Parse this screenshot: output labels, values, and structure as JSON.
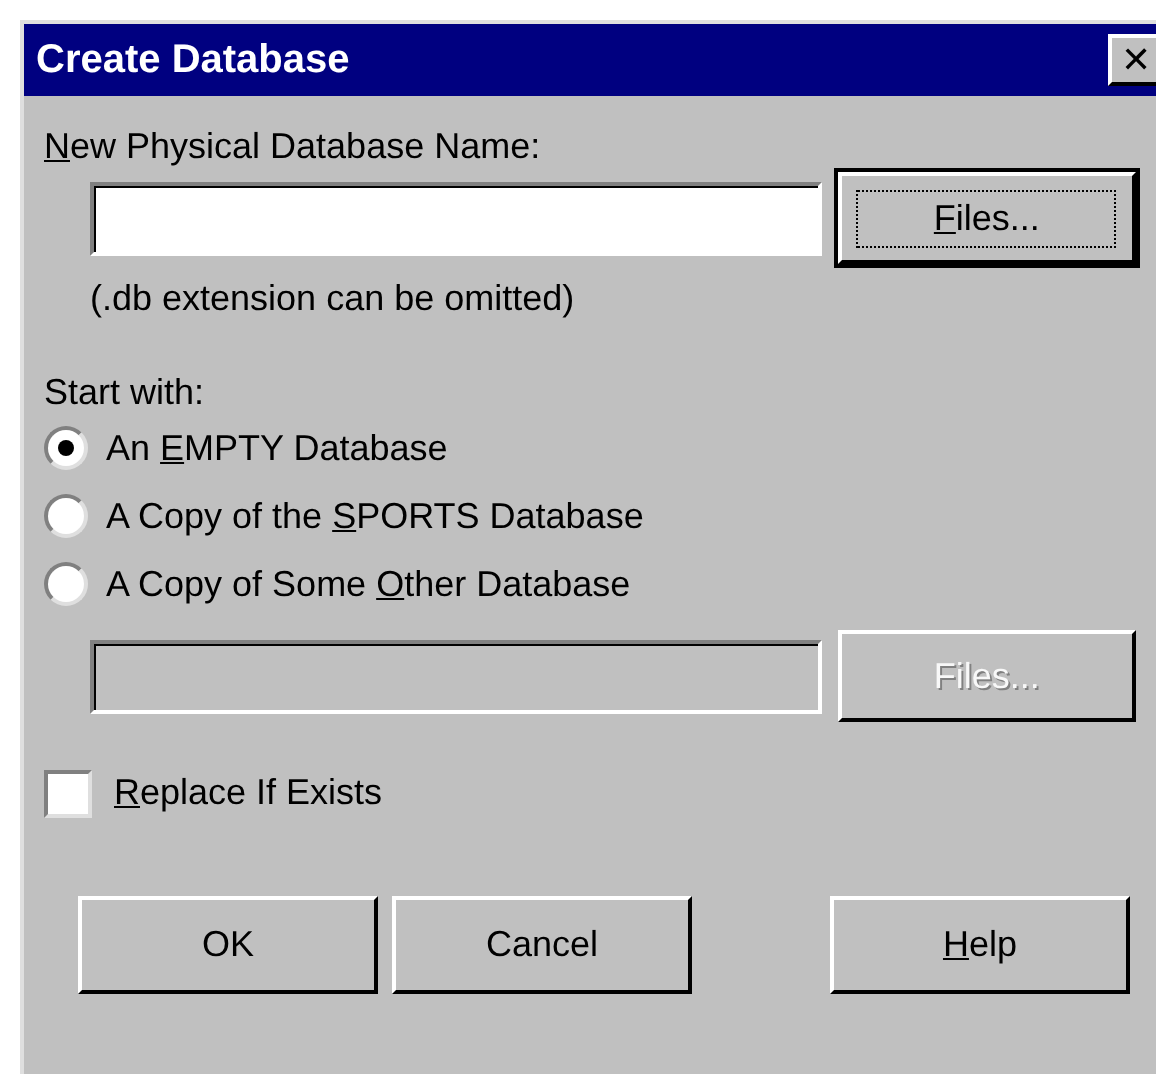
{
  "window": {
    "title": "Create Database",
    "close": "✕"
  },
  "name_field": {
    "label": {
      "key": "N",
      "after": "ew Physical Database Name:"
    },
    "button": {
      "key": "F",
      "after": "iles..."
    },
    "focused_button": true
  },
  "note": "(.db extension can be omitted)",
  "start_with": {
    "label": "Start with:",
    "options": [
      {
        "label": {
          "before": "An ",
          "key": "E",
          "after": "MPTY Database"
        },
        "selected": true
      },
      {
        "label": {
          "before": "A Copy of the ",
          "key": "S",
          "after": "PORTS Database"
        },
        "selected": false
      },
      {
        "label": {
          "before": "A Copy of Some ",
          "key": "O",
          "after": "ther Database"
        },
        "selected": false
      }
    ]
  },
  "other_field": {
    "button": {
      "after": "Files..."
    },
    "disabled": true
  },
  "replace": {
    "label": {
      "key": "R",
      "after": "eplace If Exists"
    },
    "checked": false
  },
  "buttons": [
    {
      "label": {
        "after": "OK"
      }
    },
    {
      "label": {
        "after": "Cancel"
      }
    },
    {
      "label": {
        "key": "H",
        "after": "elp"
      }
    }
  ]
}
